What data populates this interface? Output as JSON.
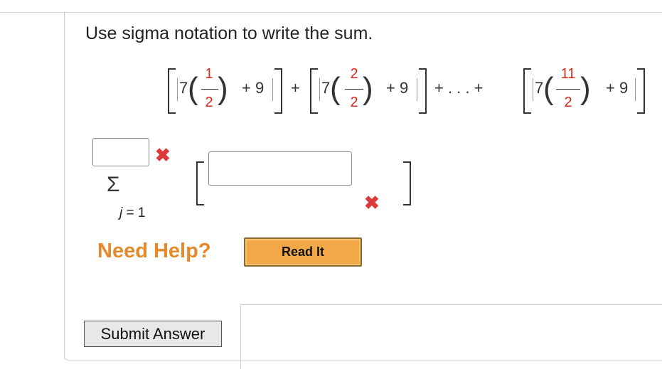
{
  "question": {
    "text": "Use sigma notation to write the sum."
  },
  "expression": {
    "terms": [
      {
        "coef": "7",
        "numerator": "1",
        "denominator": "2",
        "plus": "+ 9"
      },
      {
        "coef": "7",
        "numerator": "2",
        "denominator": "2",
        "plus": "+ 9"
      },
      {
        "coef": "7",
        "numerator": "11",
        "denominator": "2",
        "plus": "+ 9"
      }
    ],
    "plus1": "+",
    "plus2": "+ . . . +"
  },
  "answer": {
    "sigma_symbol": "Σ",
    "lower_var": "j",
    "lower_eq": "= 1",
    "upper_limit_value": "",
    "summand_value": ""
  },
  "help": {
    "need_help": "Need Help?",
    "read_it": "Read It"
  },
  "submit": {
    "label": "Submit Answer"
  },
  "colors": {
    "red": "#d8261f",
    "help_orange": "#e48a2b",
    "button_orange": "#f3a847"
  }
}
